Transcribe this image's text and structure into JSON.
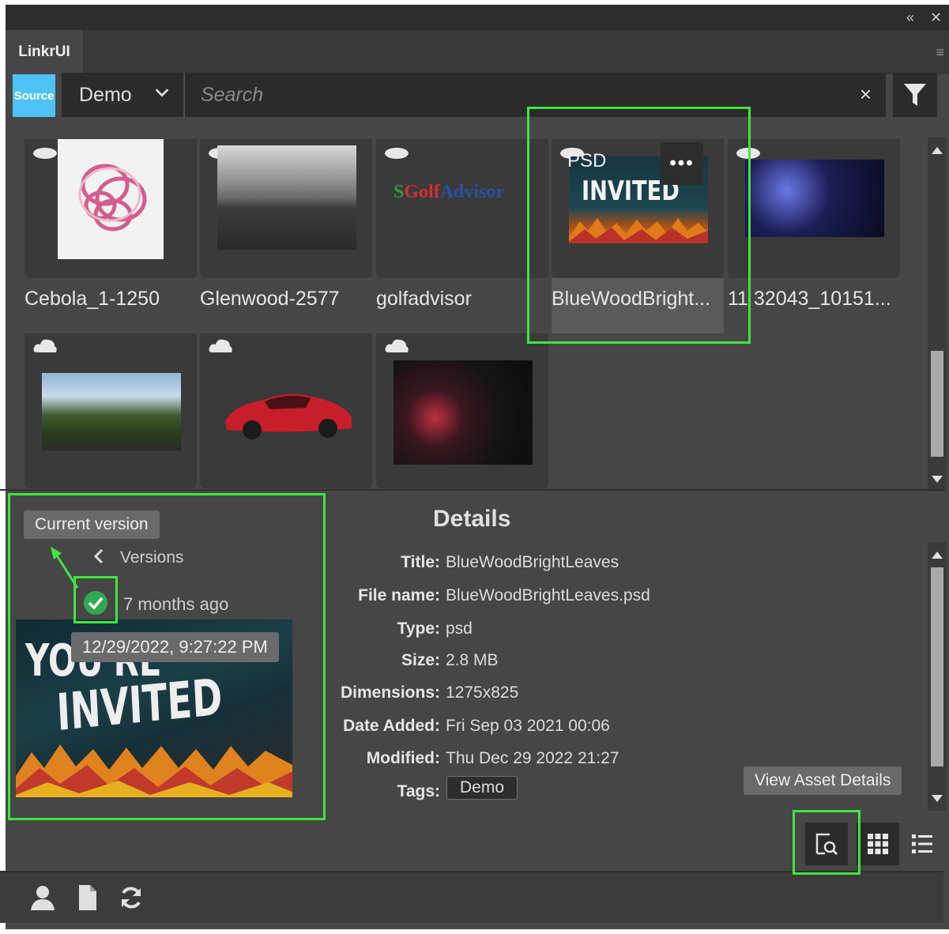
{
  "panel": {
    "tab": "LinkrUI"
  },
  "toolbar": {
    "source_label": "Source",
    "source_select": "Demo",
    "search_placeholder": "Search",
    "clear_icon": "×"
  },
  "grid": {
    "items": [
      {
        "name": "Cebola_1-1250"
      },
      {
        "name": "Glenwood-2577"
      },
      {
        "name": "golfadvisor",
        "logo_text_a": "Golf",
        "logo_text_b": "Advisor"
      },
      {
        "name": "BlueWoodBright...",
        "badge": "PSD",
        "more": "•••"
      },
      {
        "name": "11 32043_10151..."
      },
      {
        "name": ""
      },
      {
        "name": ""
      },
      {
        "name": ""
      }
    ]
  },
  "versions": {
    "current_tooltip": "Current version",
    "nav_label": "Versions",
    "entry_time": "7 months ago",
    "entry_tooltip": "12/29/2022, 9:27:22 PM",
    "preview_text_1": "YOU'RE",
    "preview_text_2": "INVITED"
  },
  "details": {
    "heading": "Details",
    "rows": [
      {
        "label": "Title:",
        "value": "BlueWoodBrightLeaves"
      },
      {
        "label": "File name:",
        "value": "BlueWoodBrightLeaves.psd"
      },
      {
        "label": "Type:",
        "value": "psd"
      },
      {
        "label": "Size:",
        "value": "2.8 MB"
      },
      {
        "label": "Dimensions:",
        "value": "1275x825"
      },
      {
        "label": "Date Added:",
        "value": "Fri Sep 03 2021 00:06"
      },
      {
        "label": "Modified:",
        "value": "Thu Dec 29 2022 21:27"
      },
      {
        "label": "Tags:",
        "value": ""
      }
    ],
    "tag": "Demo"
  },
  "view_tooltip": "View Asset Details",
  "icons": {
    "collapse": "«",
    "close": "✕",
    "menu": "≡"
  },
  "colors": {
    "accent_source": "#4fc3f7",
    "highlight": "#3fe63f",
    "check": "#33a853"
  }
}
